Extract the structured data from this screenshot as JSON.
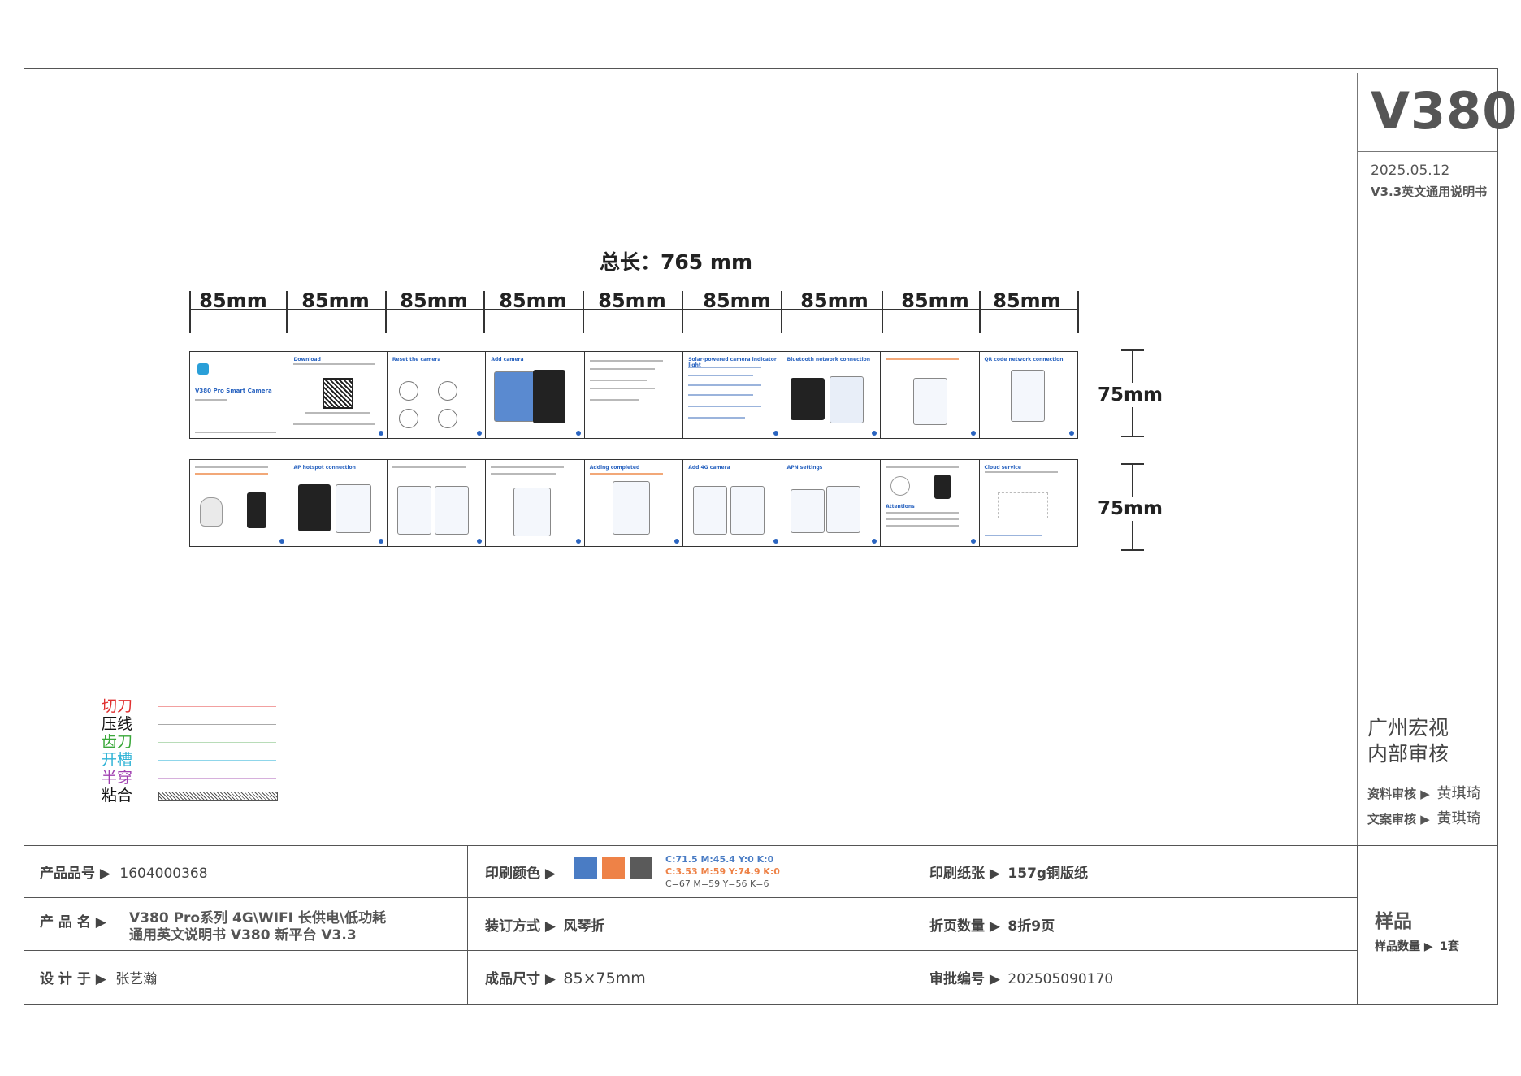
{
  "header": {
    "brand": "V380",
    "date": "2025.05.12",
    "version": "V3.3英文通用说明书"
  },
  "review": {
    "title_line1": "广州宏视",
    "title_line2": "内部审核",
    "material_label": "资料审核 ▶",
    "material_name": "黄琪琦",
    "copy_label": "文案审核 ▶",
    "copy_name": "黄琪琦"
  },
  "dimensions": {
    "total": "总长：765 mm",
    "segments": [
      "85mm",
      "85mm",
      "85mm",
      "85mm",
      "85mm",
      "85mm",
      "85mm",
      "85mm",
      "85mm"
    ],
    "height_top": "75mm",
    "height_bottom": "75mm"
  },
  "panels_top": [
    {
      "title": "V380 Pro Smart Camera"
    },
    {
      "title": "Download"
    },
    {
      "title": "Reset the camera"
    },
    {
      "title": "Add camera"
    },
    {
      "title": ""
    },
    {
      "title": "Solar-powered camera indicator light"
    },
    {
      "title": "Bluetooth network connection"
    },
    {
      "title": ""
    },
    {
      "title": "QR code network connection"
    }
  ],
  "panels_bottom": [
    {
      "title": ""
    },
    {
      "title": "AP hotspot connection"
    },
    {
      "title": ""
    },
    {
      "title": ""
    },
    {
      "title": "Adding completed"
    },
    {
      "title": "Add 4G camera"
    },
    {
      "title": "APN settings"
    },
    {
      "title": "Attentions"
    },
    {
      "title": "Cloud service"
    }
  ],
  "legend": [
    {
      "label": "切刀",
      "color": "#e03030",
      "line": "#f2a0a0"
    },
    {
      "label": "压线",
      "color": "#111111",
      "line": "#aaaaaa"
    },
    {
      "label": "齿刀",
      "color": "#3aa83a",
      "line": "#b8dcb8"
    },
    {
      "label": "开槽",
      "color": "#2fb3d6",
      "line": "#8fd6ea"
    },
    {
      "label": "半穿",
      "color": "#a040b0",
      "line": "#d6b0dc"
    },
    {
      "label": "粘合",
      "color": "#111111",
      "line": "hatch"
    }
  ],
  "info": {
    "product_no_label": "产品品号 ▶",
    "product_no": "1604000368",
    "product_name_label": "产 品 名 ▶",
    "product_name_1": "V380 Pro系列 4G\\WIFI 长供电\\低功耗",
    "product_name_2": "通用英文说明书 V380 新平台 V3.3",
    "designer_label": "设 计 于 ▶",
    "designer": "张艺瀚",
    "print_color_label": "印刷颜色 ▶",
    "binding_label": "装订方式 ▶",
    "binding": "风琴折",
    "size_label": "成品尺寸 ▶",
    "size": "85×75mm",
    "paper_label": "印刷纸张 ▶",
    "paper": "157g铜版纸",
    "pages_label": "折页数量 ▶",
    "pages": "8折9页",
    "approval_label": "审批编号 ▶",
    "approval": "202505090170",
    "sample_title": "样品",
    "sample_qty_label": "样品数量 ▶",
    "sample_qty": "1套"
  },
  "colors": {
    "blue": "#4a7cc4",
    "orange": "#ee8247",
    "gray": "#5a5a5a",
    "cmyk_blue": "C:71.5   M:45.4   Y:0    K:0",
    "cmyk_orange": "C:3.53   M:59   Y:74.9    K:0",
    "cmyk_gray": "C=67   M=59   Y=56    K=6"
  }
}
